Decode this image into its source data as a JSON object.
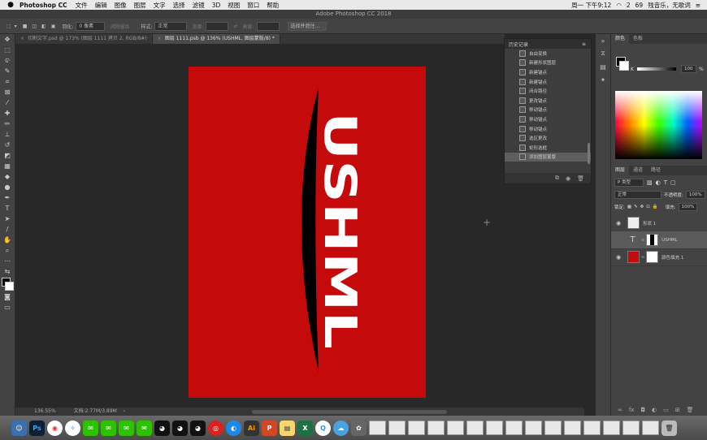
{
  "menubar": {
    "app_name": "Photoshop CC",
    "items": [
      "文件",
      "编辑",
      "图像",
      "图层",
      "文字",
      "选择",
      "滤镜",
      "3D",
      "视图",
      "窗口",
      "帮助"
    ],
    "clock": "周一 下午9:12",
    "badge_count": "2",
    "battery": "69",
    "user_status": "残音乐，无歌词"
  },
  "window": {
    "title": "Adobe Photoshop CC 2018"
  },
  "options": {
    "feather_label": "羽化:",
    "feather_value": "0 像素",
    "antialias_label": "消除锯齿",
    "style_label": "样式:",
    "style_value": "正常",
    "width_label": "宽度:",
    "height_label": "高度:",
    "select_mask_label": "选择并遮住..."
  },
  "tabs": [
    {
      "label": "切割文字.psd @ 173% (图层 1111 拷贝 2, RGB/8#)",
      "active": false
    },
    {
      "label": "图层 1111.psb @ 136% (USHML, 图层蒙版/8) *",
      "active": true
    }
  ],
  "status": {
    "zoom": "136.55%",
    "doc": "文档:2.77M/3.89M"
  },
  "history": {
    "title": "历史记录",
    "items": [
      "自由变换",
      "新建形状图层",
      "新建锚点",
      "新建锚点",
      "闭合路径",
      "更改锚点",
      "移动锚点",
      "移动锚点",
      "移动锚点",
      "选区更改",
      "矩形选框",
      "添加图层蒙版"
    ],
    "selected_index": 11
  },
  "color_panel": {
    "tabs": [
      "颜色",
      "色板"
    ],
    "k_label": "K",
    "k_value": "100",
    "k_unit": "%"
  },
  "layers_panel": {
    "tabs": [
      "图层",
      "通道",
      "路径"
    ],
    "filter_label": "P 类型",
    "blend_mode": "正常",
    "opacity_label": "不透明度:",
    "opacity_value": "100%",
    "lock_label": "锁定:",
    "fill_label": "填充:",
    "fill_value": "100%",
    "layers": [
      {
        "name": "形状 1",
        "kind": "shape"
      },
      {
        "name": "USHML",
        "kind": "text",
        "selected": true
      },
      {
        "name": "颜色填充 1",
        "kind": "fill"
      }
    ]
  },
  "canvas": {
    "artwork_text": "USHML",
    "doc_color": "#c40a0a"
  },
  "colors": {
    "accent_red": "#c40a0a"
  }
}
